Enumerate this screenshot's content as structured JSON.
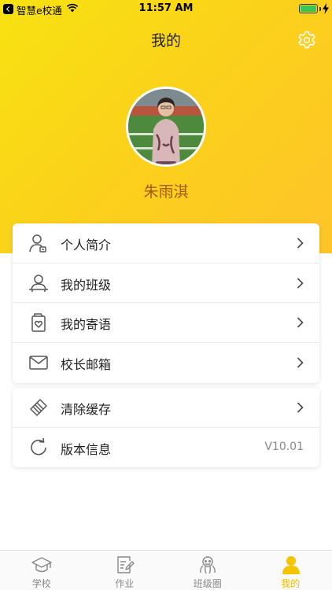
{
  "status_bar": {
    "back_app": "智慧e校通",
    "time": "11:57 AM"
  },
  "header": {
    "title": "我的"
  },
  "profile": {
    "name": "朱雨淇"
  },
  "menu_group_1": [
    {
      "label": "个人简介",
      "icon": "user-profile-icon"
    },
    {
      "label": "我的班级",
      "icon": "class-user-icon"
    },
    {
      "label": "我的寄语",
      "icon": "message-heart-icon"
    },
    {
      "label": "校长邮箱",
      "icon": "mail-icon"
    }
  ],
  "menu_group_2": [
    {
      "label": "清除缓存",
      "icon": "broom-icon"
    },
    {
      "label": "版本信息",
      "icon": "refresh-icon",
      "value": "V10.01"
    }
  ],
  "tabbar": {
    "items": [
      {
        "label": "学校",
        "icon": "graduation-cap-icon",
        "active": false
      },
      {
        "label": "作业",
        "icon": "homework-icon",
        "active": false
      },
      {
        "label": "班级圈",
        "icon": "class-circle-icon",
        "active": false
      },
      {
        "label": "我的",
        "icon": "person-icon",
        "active": true
      }
    ]
  },
  "colors": {
    "header_gradient_start": "#f7e211",
    "header_gradient_end": "#fec429",
    "accent": "#f2b800",
    "username": "#a25a12"
  }
}
